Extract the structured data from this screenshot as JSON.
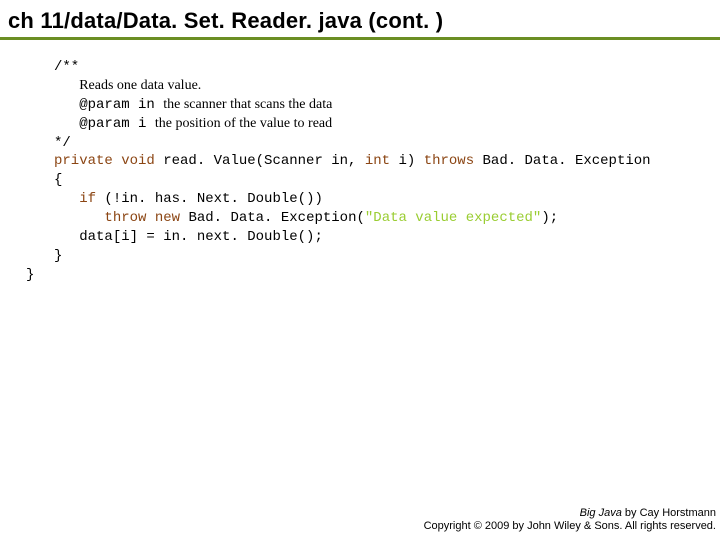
{
  "title": "ch 11/data/Data. Set. Reader. java (cont. )",
  "code": {
    "doc_open": "/**",
    "doc_line1": "Reads one data value.",
    "doc_line2a": "@param in ",
    "doc_line2b": "the scanner that scans the data",
    "doc_line3a": "@param i ",
    "doc_line3b": "the position of the value to read",
    "doc_close": "*/",
    "sig_kw1": "private void",
    "sig_mid": " read. Value(Scanner in, ",
    "sig_kw2": "int",
    "sig_mid2": " i) ",
    "sig_kw3": "throws",
    "sig_end": " Bad. Data. Exception",
    "brace_open": "{",
    "if_kw": "if",
    "if_rest": " (!in. has. Next. Double())",
    "throw_kw": "throw new",
    "throw_mid": " Bad. Data. Exception(",
    "throw_str": "\"Data value expected\"",
    "throw_end": "); ",
    "assign": "data[i] = in. next. Double();",
    "brace_close1": "}",
    "brace_close2": "}"
  },
  "footer": {
    "book": "Big Java",
    "byline": " by Cay Horstmann",
    "copyright": "Copyright © 2009 by John Wiley & Sons. All rights reserved."
  }
}
